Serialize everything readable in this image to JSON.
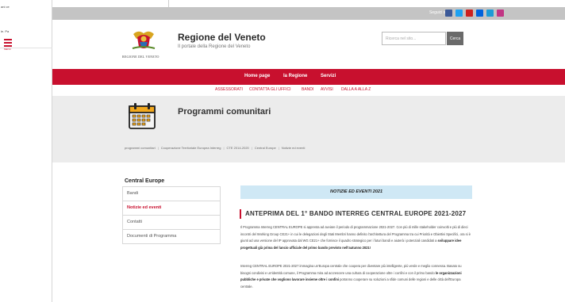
{
  "left_panel": {
    "text_1": "ani ce",
    "text_2": "le. Pa"
  },
  "social": {
    "label": "Seguici su",
    "icons": [
      {
        "name": "facebook-icon",
        "color": "#3b5998"
      },
      {
        "name": "twitter-icon",
        "color": "#1da1f2"
      },
      {
        "name": "youtube-icon",
        "color": "#cd201f"
      },
      {
        "name": "flickr-icon",
        "color": "#0063dc"
      },
      {
        "name": "email-icon",
        "color": "#1c9bd6"
      },
      {
        "name": "instagram-icon",
        "color": "#c13584"
      }
    ]
  },
  "header": {
    "menu_label": "MENU",
    "logo_caption": "REGIONE DEL VENETO",
    "title": "Regione del Veneto",
    "subtitle": "Il portale della Regione del Veneto",
    "search_placeholder": "Ricerca nel sito...",
    "search_button": "Cerca"
  },
  "nav": {
    "items": [
      "Home page",
      "la Regione",
      "Servizi"
    ],
    "sub_items": [
      "ASSESSORATI",
      "CONTATTA GLI UFFICI",
      "BANDI",
      "AVVISI",
      "DALLA A ALLA Z"
    ]
  },
  "page": {
    "title": "Programmi comunitari",
    "breadcrumb": [
      "programmi comunitari",
      "Cooperazione Territoriale Europea Interreg",
      "CTE 2014-2020",
      "Central Europe",
      "Notizie ed eventi"
    ]
  },
  "sidebar": {
    "title": "Central Europe",
    "items": [
      "Bandi",
      "Notizie ed eventi",
      "Contatti",
      "Documenti di Programma"
    ]
  },
  "article": {
    "banner": "NOTIZIE ED EVENTI 2021",
    "title": "ANTEPRIMA DEL 1° BANDO INTERREG CENTRAL EUROPE 2021-2027",
    "p1_a": "Il Programma Interreg CENTRAL EUROPE si appresta ad avviare il periodo di programmazione 2021-2027. Con più di mille stakeholder coinvolti e più di dieci incontri del Working Group CE21+ in cui le delegazioni degli Stati Membri hanno definito l'architettura del Programma tra cui Priorità e Obiettivi Specifici, ora si è giunti ad una versione del IP approvata dal WG CE21+ che fornisce il quadro strategico per i futuri bandi e aiuterà i potenziali candidati a ",
    "p1_b": "sviluppare idee progettuali già prima del lancio ufficiale del primo bando previsto nell'autunno 2021!",
    "p2_a": "Interreg CENTRAL EUROPE 2021-2027 immagina un'Europa centrale che coopera per diventare più intelligente, più verde e meglio connessa. Basato su bisogni condivisi e un'identità comune, il Programma mira ad accrescere una cultura di cooperazione oltre i confini e con il primo bando ",
    "p2_b": "le organizzazioni pubbliche e private che vogliono lavorare insieme oltre i confini",
    "p2_c": " potranno cooperare su soluzioni a sfide comuni delle regioni e delle città dell'Europa centrale."
  }
}
